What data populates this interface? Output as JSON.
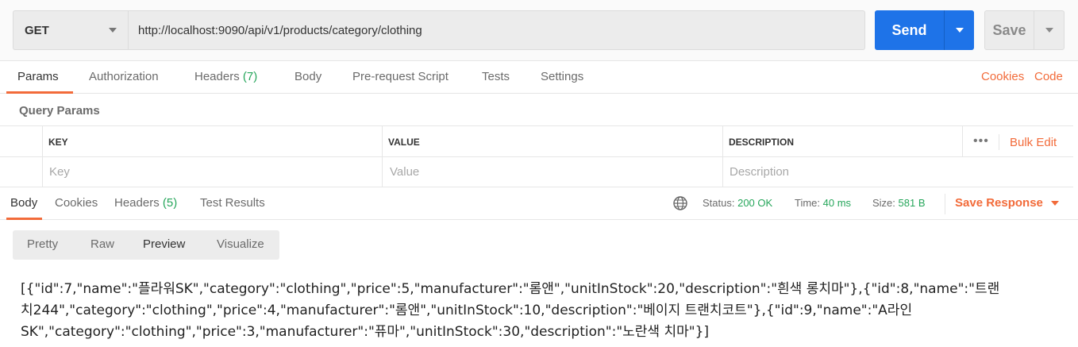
{
  "request": {
    "method": "GET",
    "url": "http://localhost:9090/api/v1/products/category/clothing",
    "send_label": "Send",
    "save_label": "Save"
  },
  "request_tabs": [
    {
      "label": "Params",
      "count": ""
    },
    {
      "label": "Authorization",
      "count": ""
    },
    {
      "label": "Headers",
      "count": "(7)"
    },
    {
      "label": "Body",
      "count": ""
    },
    {
      "label": "Pre-request Script",
      "count": ""
    },
    {
      "label": "Tests",
      "count": ""
    },
    {
      "label": "Settings",
      "count": ""
    }
  ],
  "request_links": {
    "cookies": "Cookies",
    "code": "Code"
  },
  "query_params": {
    "title": "Query Params",
    "headers": {
      "key": "KEY",
      "value": "VALUE",
      "description": "DESCRIPTION"
    },
    "placeholders": {
      "key": "Key",
      "value": "Value",
      "description": "Description"
    },
    "more": "•••",
    "bulk_edit": "Bulk Edit"
  },
  "response_tabs": [
    {
      "label": "Body",
      "count": ""
    },
    {
      "label": "Cookies",
      "count": ""
    },
    {
      "label": "Headers",
      "count": "(5)"
    },
    {
      "label": "Test Results",
      "count": ""
    }
  ],
  "response_meta": {
    "status_label": "Status:",
    "status": "200 OK",
    "time_label": "Time:",
    "time": "40 ms",
    "size_label": "Size:",
    "size": "581 B",
    "save_response": "Save Response"
  },
  "view_modes": [
    "Pretty",
    "Raw",
    "Preview",
    "Visualize"
  ],
  "response_body_lines": [
    "[{\"id\":7,\"name\":\"플라워SK\",\"category\":\"clothing\",\"price\":5,\"manufacturer\":\"롬앤\",\"unitInStock\":20,\"description\":\"흰색 롱치마\"},{\"id\":8,\"name\":\"트랜",
    "치244\",\"category\":\"clothing\",\"price\":4,\"manufacturer\":\"롬앤\",\"unitInStock\":10,\"description\":\"베이지 트랜치코트\"},{\"id\":9,\"name\":\"A라인",
    "SK\",\"category\":\"clothing\",\"price\":3,\"manufacturer\":\"퓨마\",\"unitInStock\":30,\"description\":\"노란색 치마\"}]"
  ],
  "colors": {
    "accent": "#f26b3a",
    "send": "#1e73e8",
    "success": "#26a65b"
  }
}
